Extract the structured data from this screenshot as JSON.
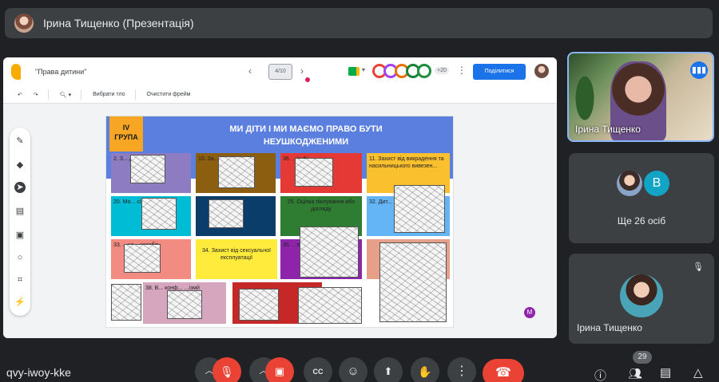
{
  "presenter": {
    "name": "Ірина Тищенко (Презентація)"
  },
  "jamboard": {
    "doc_title": "\"Права дитини\"",
    "frame_label": "4/10",
    "share_label": "Поділитися",
    "collab_count": "+20",
    "toolbar": {
      "pick_background": "Вибрати тло",
      "clear_frame": "Очистити фрейм"
    },
    "badge_letter": "M"
  },
  "slide": {
    "group_label_line1": "IV",
    "group_label_line2": "ГРУПА",
    "title_line1": "МИ ДІТИ І МИ МАЄМО ПРАВО БУТИ",
    "title_line2": "НЕУШКОДЖЕНИМИ",
    "cells": [
      "2. З... ди...",
      "10. За... насе...",
      "36. ...іх фі...",
      "11. Захист від викрадення та насильницького вивезен...",
      "20. Мо... сім'ї",
      "",
      "25. Оцінка піклування або догляду",
      "32. Дит...",
      "33. ...на... засобів",
      "34. Захист від сексуальної експлуатації",
      "35. ...пр... гівл...",
      "",
      "38. В... конф... ...ізмй"
    ]
  },
  "participants": {
    "main_name": "Ірина Тищенко",
    "others_label": "Ще 26 осіб",
    "avatar_letter": "B",
    "tile3_name": "Ірина Тищенко",
    "count": "29"
  },
  "meeting": {
    "code": "qvy-iwoy-kke"
  },
  "colors": {
    "accent": "#1a73e8",
    "end_call": "#ea4335",
    "slide_blue": "#5b7fde"
  }
}
